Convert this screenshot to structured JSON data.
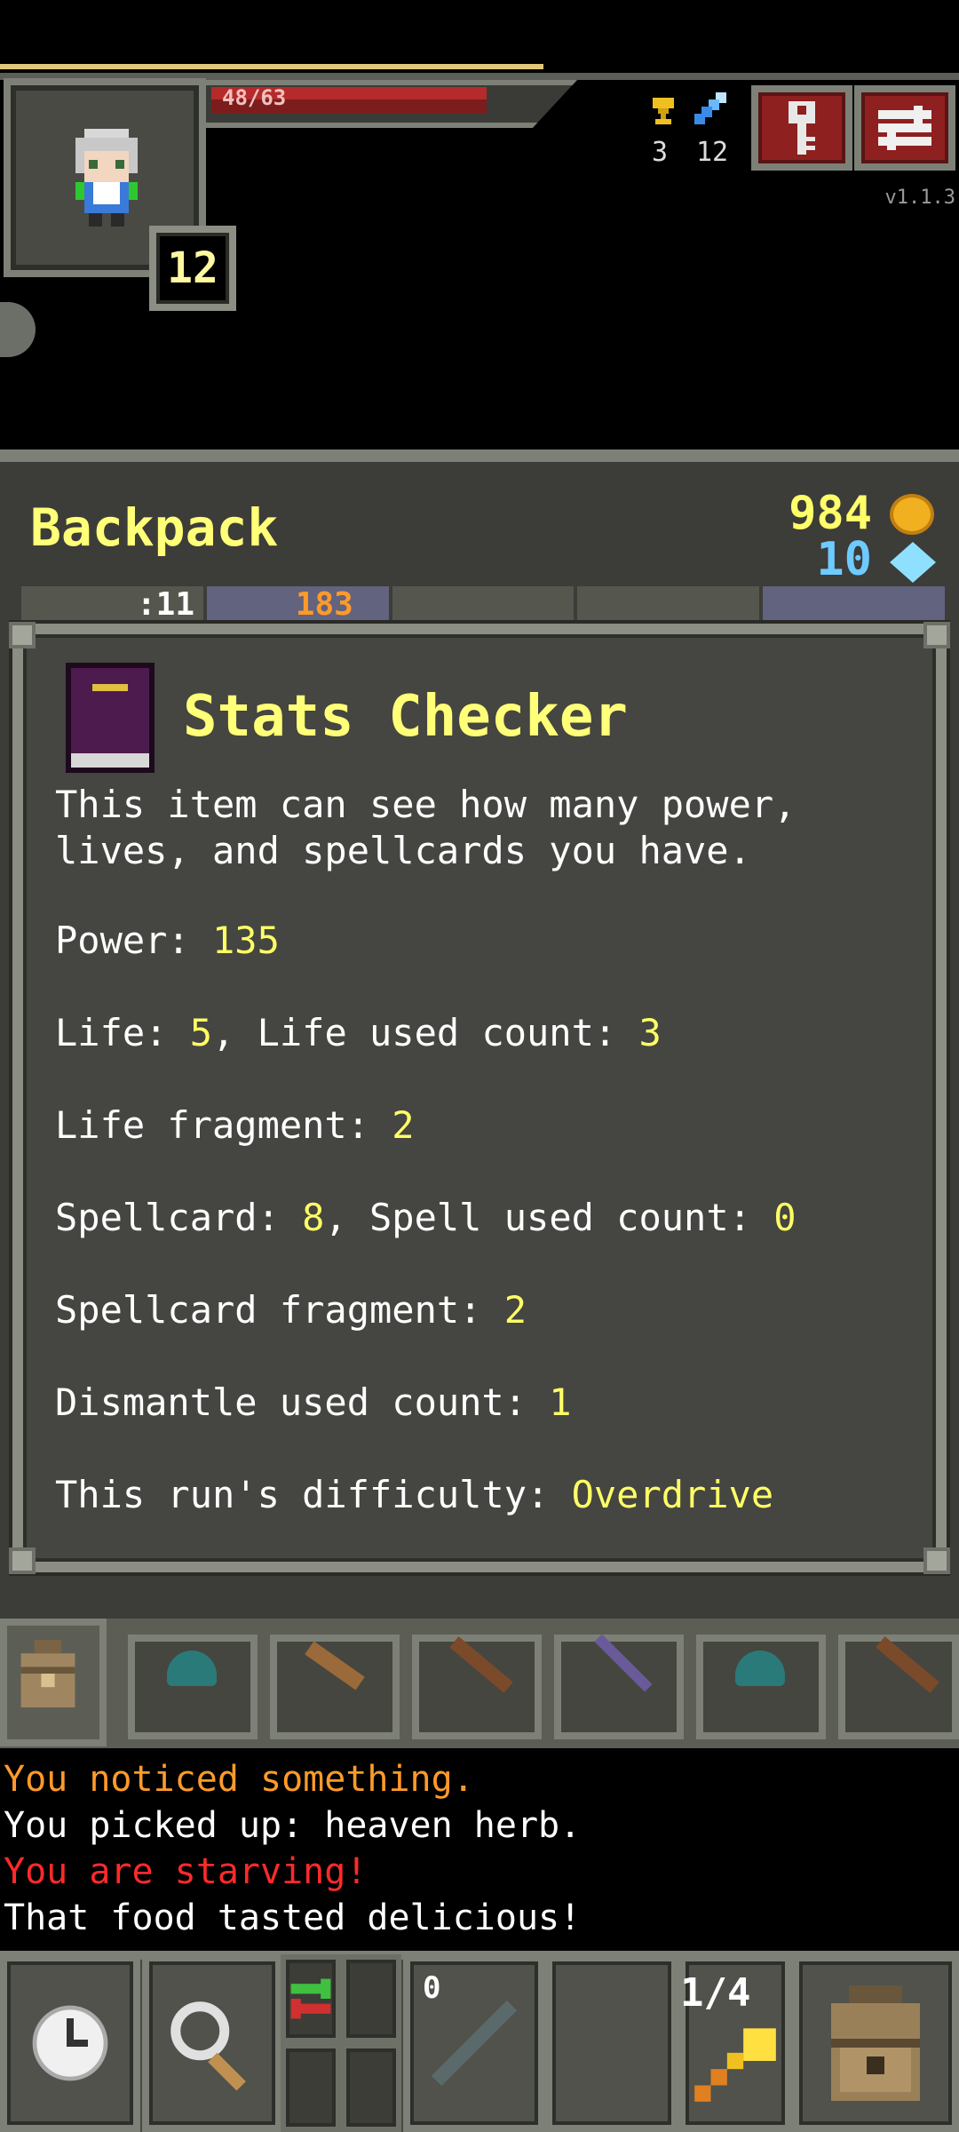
{
  "hud": {
    "hp": "48/63",
    "buff_1_icon": "trophy-icon",
    "buff_1_value": "3",
    "buff_2_icon": "sword-icon",
    "buff_2_value": "12",
    "level": "12",
    "version": "v1.1.3",
    "key_button_icon": "key-icon",
    "menu_button_icon": "menu-icon"
  },
  "backpack": {
    "title": "Backpack",
    "gold": "984",
    "gems": "10",
    "tab_counts": [
      ":11",
      "183"
    ]
  },
  "item": {
    "icon": "book-icon",
    "name": "Stats Checker",
    "description": "This item can see how many power, lives, and spellcards you have.",
    "stats": {
      "power_label": "Power: ",
      "power_value": "135",
      "life_label": "Life: ",
      "life_value": "5",
      "life_used_label": ", Life used count: ",
      "life_used_value": "3",
      "life_fragment_label": "Life fragment: ",
      "life_fragment_value": "2",
      "spellcard_label": "Spellcard: ",
      "spellcard_value": "8",
      "spell_used_label": ", Spell used count: ",
      "spell_used_value": "0",
      "spellcard_fragment_label": "Spellcard fragment: ",
      "spellcard_fragment_value": "2",
      "dismantle_label": "Dismantle used count: ",
      "dismantle_value": "1",
      "difficulty_label": "This run's difficulty: ",
      "difficulty_value": "Overdrive"
    }
  },
  "log": [
    {
      "text": "You noticed something.",
      "color": "#ff9a2a"
    },
    {
      "text": "You picked up: heaven herb.",
      "color": "#ffffff"
    },
    {
      "text": "You are starving!",
      "color": "#ff2a2a"
    },
    {
      "text": "That food tasted delicious!",
      "color": "#ffffff"
    }
  ],
  "toolbar": {
    "wait_icon": "clock-icon",
    "search_icon": "magnifier-icon",
    "swap_icon": "swap-icon",
    "quickslot_count": "0",
    "wand_charges": "1/4",
    "backpack_icon": "backpack-icon"
  },
  "colors": {
    "accent_yellow": "#ffff78",
    "panel": "#454541",
    "frame": "#8b8e83"
  }
}
